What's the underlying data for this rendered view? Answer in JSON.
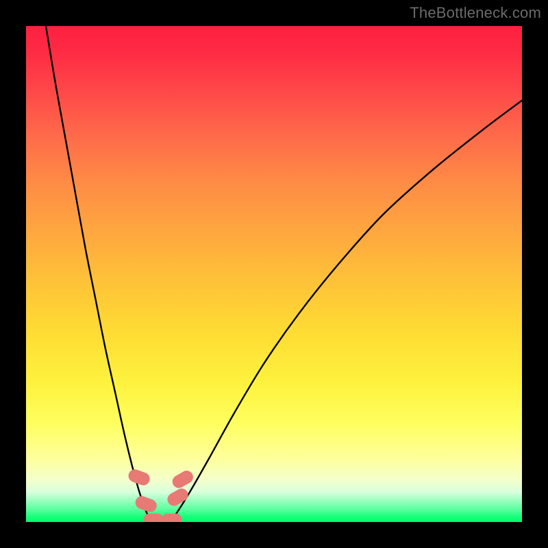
{
  "watermark": "TheBottleneck.com",
  "chart_data": {
    "type": "line",
    "title": "",
    "xlabel": "",
    "ylabel": "",
    "xlim": [
      0,
      100
    ],
    "ylim": [
      0,
      100
    ],
    "series": [
      {
        "name": "left-branch",
        "x": [
          4,
          6,
          8,
          10,
          12,
          14,
          16,
          18,
          20,
          22,
          23.5,
          24.5,
          25.5
        ],
        "y": [
          100,
          88,
          77,
          66,
          55,
          45,
          35,
          26,
          17,
          9,
          4,
          1.5,
          0
        ]
      },
      {
        "name": "right-branch",
        "x": [
          29,
          30.5,
          33,
          37,
          42,
          48,
          55,
          63,
          72,
          82,
          92,
          100
        ],
        "y": [
          0,
          2,
          6,
          13,
          22,
          32,
          42,
          52,
          62,
          71,
          79,
          85
        ]
      },
      {
        "name": "valley-floor",
        "x": [
          25.5,
          27,
          29
        ],
        "y": [
          0,
          0,
          0
        ]
      }
    ],
    "markers": [
      {
        "name": "left-marker-upper",
        "shape": "rounded-rect",
        "color": "#e77a74",
        "x": 22.8,
        "y": 9.0,
        "w": 2.6,
        "h": 4.4,
        "angle": -70
      },
      {
        "name": "left-marker-lower",
        "shape": "rounded-rect",
        "color": "#e77a74",
        "x": 24.2,
        "y": 3.6,
        "w": 2.6,
        "h": 4.4,
        "angle": -70
      },
      {
        "name": "right-marker-upper",
        "shape": "rounded-rect",
        "color": "#e77a74",
        "x": 31.6,
        "y": 8.6,
        "w": 2.6,
        "h": 4.4,
        "angle": 60
      },
      {
        "name": "right-marker-lower",
        "shape": "rounded-rect",
        "color": "#e77a74",
        "x": 30.6,
        "y": 5.0,
        "w": 2.6,
        "h": 4.4,
        "angle": 60
      },
      {
        "name": "floor-marker-left",
        "shape": "rounded-rect",
        "color": "#e77a74",
        "x": 25.7,
        "y": 0.5,
        "w": 4.0,
        "h": 2.4,
        "angle": 0
      },
      {
        "name": "floor-marker-right",
        "shape": "rounded-rect",
        "color": "#e77a74",
        "x": 29.4,
        "y": 0.5,
        "w": 4.0,
        "h": 2.4,
        "angle": 0
      }
    ],
    "gradient_stops": [
      {
        "pos": 0,
        "color": "#fe2040"
      },
      {
        "pos": 0.5,
        "color": "#fec936"
      },
      {
        "pos": 0.85,
        "color": "#feff9a"
      },
      {
        "pos": 1.0,
        "color": "#00ff6c"
      }
    ]
  }
}
